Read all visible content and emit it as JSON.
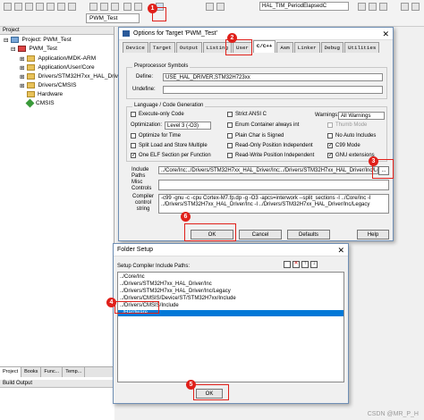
{
  "toolbar": {
    "target_name": "PWM_Test",
    "file_tab": "HAL_TIM_PeriodElapsedC"
  },
  "project_panel": {
    "title": "Project",
    "root": "Project: PWM_Test",
    "target": "PWM_Test",
    "items": [
      "Application/MDK-ARM",
      "Application/User/Core",
      "Drivers/STM32H7xx_HAL_Driver",
      "Drivers/CMSIS",
      "Hardware",
      "CMSIS"
    ],
    "bottom_tabs": [
      "Project",
      "Books",
      "Func...",
      "Temp..."
    ],
    "build_output": "Build Output"
  },
  "options_dialog": {
    "title": "Options for Target 'PWM_Test'",
    "tabs": [
      "Device",
      "Target",
      "Output",
      "Listing",
      "User",
      "C/C++",
      "Asm",
      "Linker",
      "Debug",
      "Utilities"
    ],
    "active_tab": "C/C++",
    "preprocessor": {
      "group_title": "Preprocessor Symbols",
      "define_label": "Define:",
      "define_value": "USE_HAL_DRIVER,STM32H723xx",
      "undefine_label": "Undefine:",
      "undefine_value": ""
    },
    "codegen": {
      "group_title": "Language / Code Generation",
      "execute_only": "Execute-only Code",
      "optimization_label": "Optimization:",
      "optimization_value": "Level 3 (-O3)",
      "optimize_time": "Optimize for Time",
      "split_load": "Split Load and Store Multiple",
      "one_elf": "One ELF Section per Function",
      "strict_ansi": "Strict ANSI C",
      "enum_container": "Enum Container always int",
      "plain_char": "Plain Char is Signed",
      "ro_pi": "Read-Only Position Independent",
      "rw_pi": "Read-Write Position Independent",
      "warnings_label": "Warnings:",
      "warnings_value": "All Warnings",
      "thumb_mode": "Thumb Mode",
      "no_auto_includes": "No Auto Includes",
      "c99": "C99 Mode",
      "gnu_ext": "GNU extensions"
    },
    "include_label": "Include Paths",
    "include_value": "../Core/Inc;../Drivers/STM32H7xx_HAL_Driver/Inc;../Drivers/STM32H7xx_HAL_Driver/Inc/Legacy",
    "browse_label": "...",
    "misc_label": "Misc Controls",
    "compiler_label": "Compiler control string",
    "compiler_value": "-c99 -gnu -c -cpu Cortex-M7.fp.dp -g -O3 -apcs=interwork --split_sections -I ../Core/Inc -I ../Drivers/STM32H7xx_HAL_Driver/Inc -I ../Drivers/STM32H7xx_HAL_Driver/Inc/Legacy",
    "buttons": {
      "ok": "OK",
      "cancel": "Cancel",
      "defaults": "Defaults",
      "help": "Help"
    }
  },
  "folder_dialog": {
    "title": "Folder Setup",
    "list_label": "Setup Compiler Include Paths:",
    "paths": [
      "../Core/Inc",
      "../Drivers/STM32H7xx_HAL_Driver/Inc",
      "../Drivers/STM32H7xx_HAL_Driver/Inc/Legacy",
      "../Drivers/CMSIS/Device/ST/STM32H7xx/Include",
      "../Drivers/CMSIS/Include",
      "../Hardware"
    ],
    "selected_index": 5,
    "ok": "OK"
  },
  "annotations": [
    "1",
    "2",
    "3",
    "4",
    "5",
    "6"
  ],
  "watermark": "CSDN @MR_P_H",
  "colors": {
    "annotation": "#e0201a",
    "selection": "#0078d7"
  }
}
